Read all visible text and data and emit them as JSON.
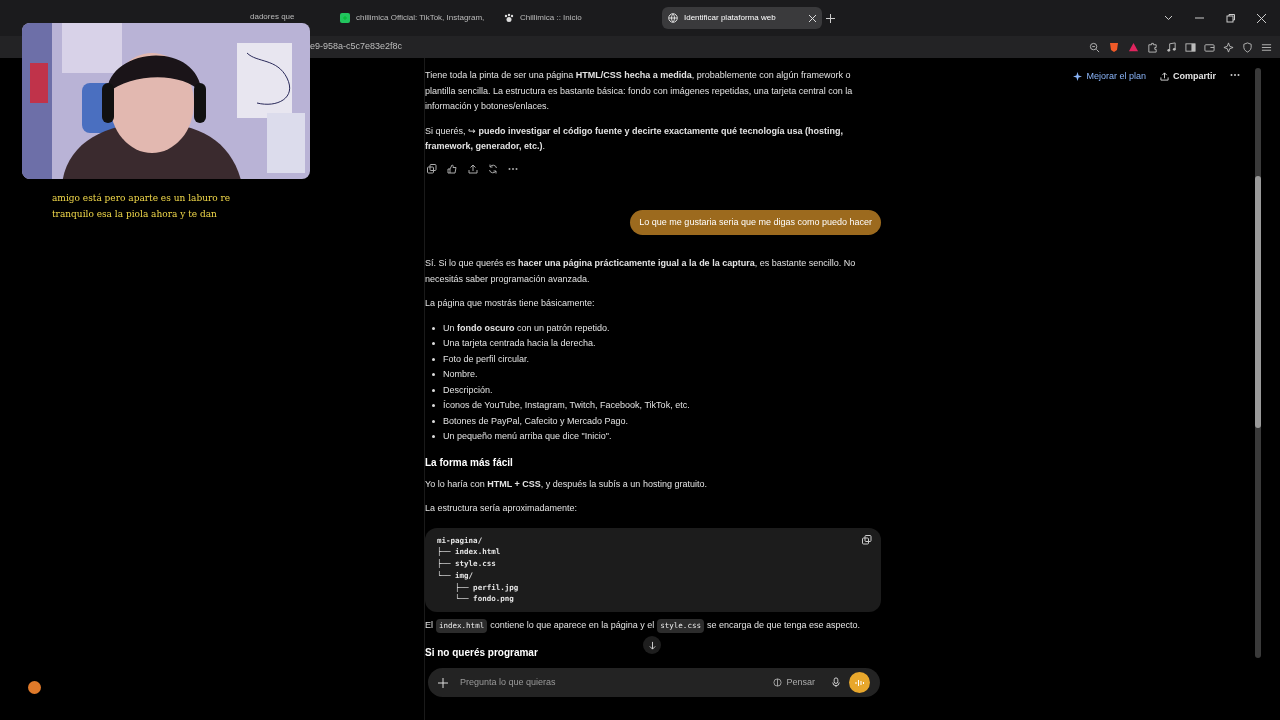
{
  "browser": {
    "tabs": [
      {
        "title": "dadores que",
        "selected": false
      },
      {
        "title": "chillimica Official: TikTok, Instagram,",
        "selected": false
      },
      {
        "title": "Chillimica :: Inicio",
        "selected": false
      },
      {
        "title": "Identificar plataforma web",
        "selected": true
      }
    ],
    "url": "e9-958a-c5c7e83e2f8c"
  },
  "stream_overlay": {
    "subtitles": [
      "amigo está pero aparte es un laburo re",
      "tranquilo esa la piola ahora y te dan"
    ]
  },
  "chat_header": {
    "upgrade": "Mejorar el plan",
    "share": "Compartir"
  },
  "messages": [
    {
      "kind": "p",
      "text": "Tiene toda la pinta de ser una página **HTML/CSS hecha a medida**, probablemente con algún framework o plantilla sencilla. La estructura es bastante básica: fondo con imágenes repetidas, una tarjeta central con la información y botones/enlaces."
    },
    {
      "kind": "p",
      "text": "Si querés, ↪ **puedo investigar el código fuente y decirte exactamente qué tecnología usa (hosting, framework, generador, etc.)**."
    },
    {
      "kind": "actions"
    },
    {
      "kind": "user",
      "text": "Lo que me gustaria seria que me digas como puedo hacer"
    },
    {
      "kind": "p",
      "text": "Sí. Si lo que querés es **hacer una página prácticamente igual a la de la captura**, es bastante sencillo. No necesitás saber programación avanzada."
    },
    {
      "kind": "p",
      "text": "La página que mostrás tiene básicamente:"
    },
    {
      "kind": "ul",
      "items": [
        "Un **fondo oscuro** con un patrón repetido.",
        "Una tarjeta centrada hacia la derecha.",
        "Foto de perfil circular.",
        "Nombre.",
        "Descripción.",
        "Íconos de YouTube, Instagram, Twitch, Facebook, TikTok, etc.",
        "Botones de PayPal, Cafecito y Mercado Pago.",
        "Un pequeño menú arriba que dice \"Inicio\"."
      ]
    },
    {
      "kind": "h",
      "text": "La forma más fácil"
    },
    {
      "kind": "p",
      "text": "Yo lo haría con **HTML + CSS**, y después la subís a un hosting gratuito."
    },
    {
      "kind": "p",
      "text": "La estructura sería aproximadamente:"
    },
    {
      "kind": "code",
      "lines": [
        "mi-pagina/",
        "├── index.html",
        "├── style.css",
        "└── img/",
        "    ├── perfil.jpg",
        "    └── fondo.png"
      ]
    },
    {
      "kind": "segments",
      "parts": [
        {
          "text": "El",
          "code": false
        },
        {
          "text": "index.html",
          "code": true
        },
        {
          "text": "contiene lo que aparece en la página y el",
          "code": false
        },
        {
          "text": "style.css",
          "code": true
        },
        {
          "text": "se encarga de que tenga ese aspecto.",
          "code": false
        }
      ]
    },
    {
      "kind": "h",
      "text": "Si no querés programar"
    }
  ],
  "composer": {
    "placeholder": "Pregunta lo que quieras",
    "think": "Pensar"
  }
}
